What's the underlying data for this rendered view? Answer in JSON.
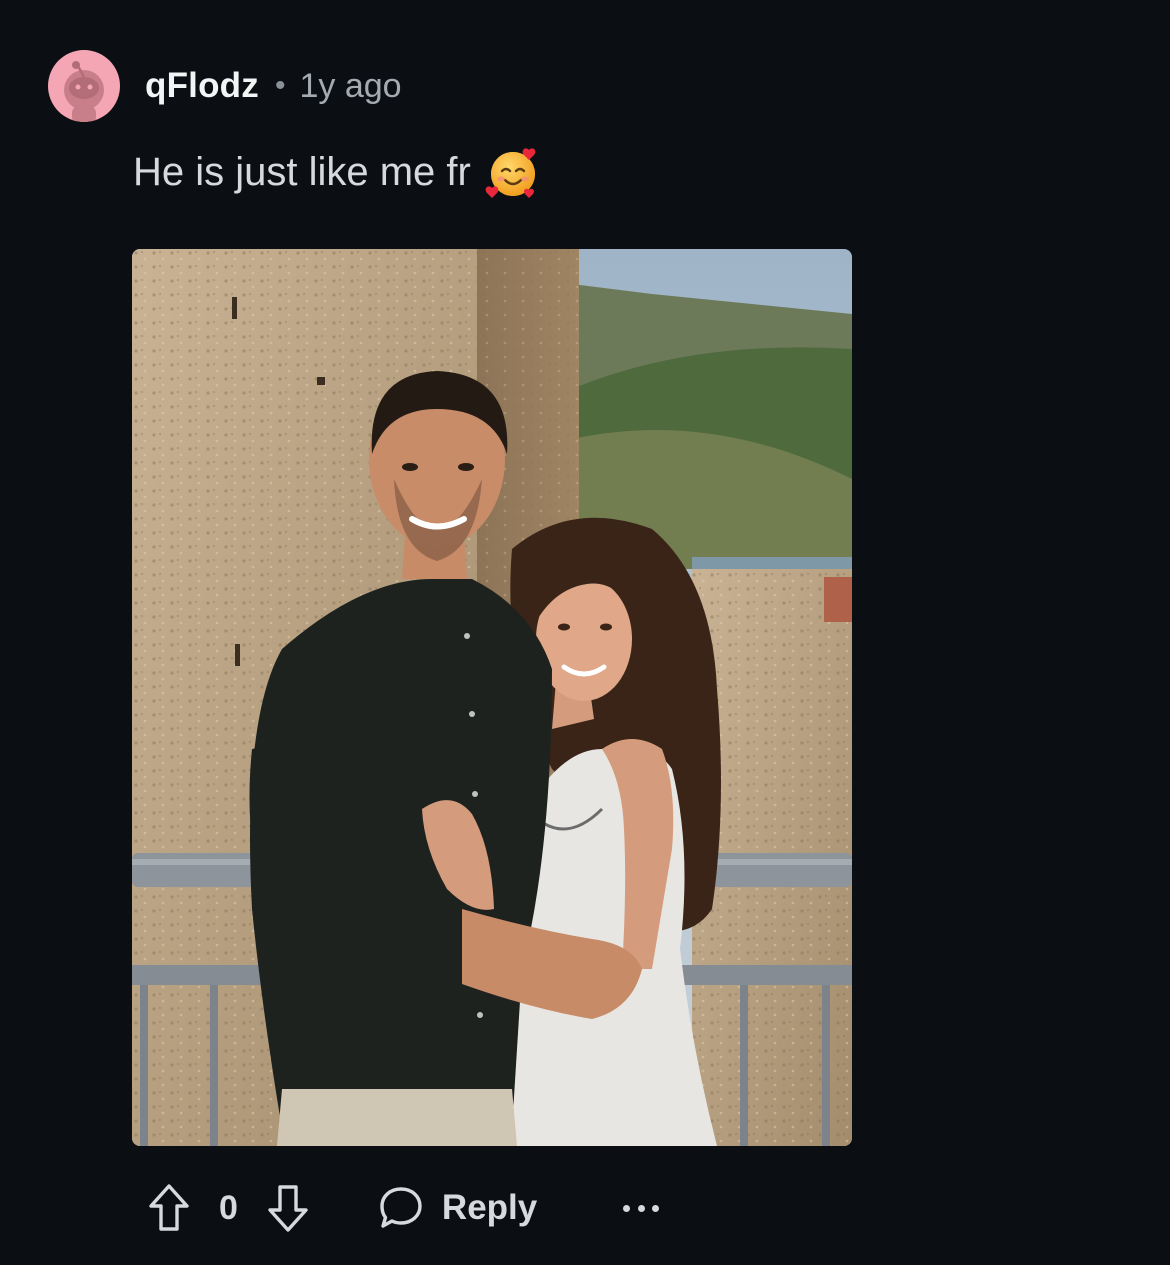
{
  "comment": {
    "username": "qFlodz",
    "separator": "•",
    "timestamp": "1y ago",
    "text": "He is just like me fr",
    "emoji": "smiling-face-with-hearts-icon",
    "image": {
      "alt": "Couple posing in front of a stone castle wall and mountains"
    }
  },
  "actions": {
    "score": "0",
    "reply_label": "Reply"
  },
  "colors": {
    "background": "#0b0f14",
    "avatar": "#f4a6b4",
    "text_primary": "#f2f4f5",
    "text_secondary": "#a4abb0"
  }
}
